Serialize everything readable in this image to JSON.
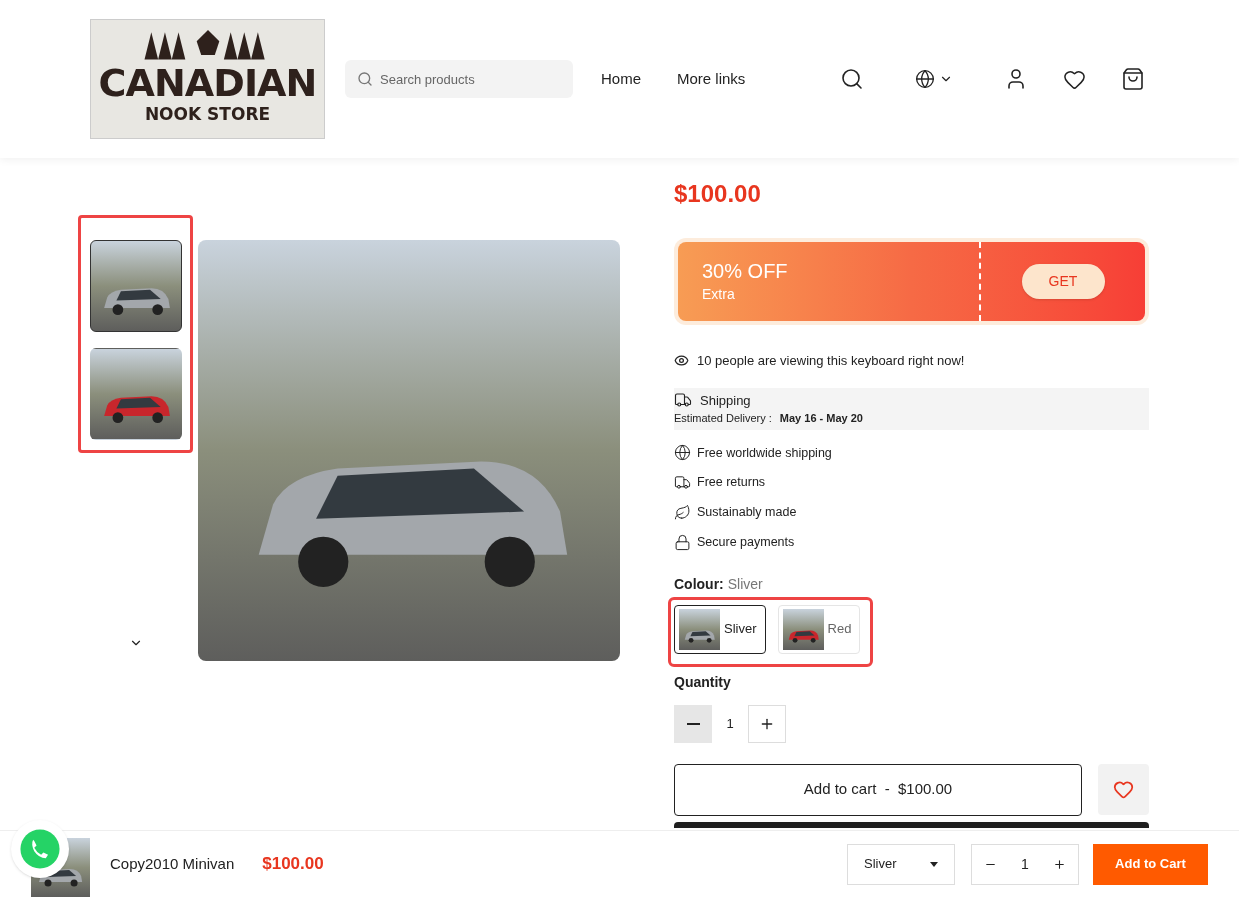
{
  "header": {
    "logo": {
      "line_1": "CANADIAN",
      "line_2": "NOOK STORE"
    },
    "search": {
      "placeholder": "Search products"
    },
    "nav": [
      "Home",
      "More links"
    ]
  },
  "gallery": {
    "thumbnails": [
      {
        "kind": "silver",
        "selected": true
      },
      {
        "kind": "red",
        "selected": false
      }
    ],
    "highlighted": true
  },
  "product": {
    "price": "$100.00",
    "coupon": {
      "title": "30% OFF",
      "subtitle": "Extra",
      "button": "GET"
    },
    "viewers": "10 people are viewing this keyboard right now!",
    "shipping": {
      "title": "Shipping",
      "label": "Estimated Delivery :",
      "dates": "May 16 - May 20"
    },
    "features": [
      {
        "kind": "globe",
        "text": "Free worldwide shipping"
      },
      {
        "kind": "truck",
        "text": "Free returns"
      },
      {
        "kind": "leaf",
        "text": "Sustainably made"
      },
      {
        "kind": "lock",
        "text": "Secure payments"
      }
    ],
    "colour": {
      "label": "Colour:",
      "value": "Sliver",
      "highlighted": true,
      "options": [
        {
          "kind": "silver",
          "label": "Sliver",
          "selected": true
        },
        {
          "kind": "red",
          "label": "Red",
          "selected": false
        }
      ]
    },
    "quantity": {
      "label": "Quantity",
      "value": "1"
    },
    "add_to_cart": "Add to cart  -  $100.00"
  },
  "sticky_bar": {
    "title": "Copy2010 Minivan",
    "price": "$100.00",
    "variant": "Sliver",
    "quantity": "1",
    "button": "Add to Cart"
  }
}
